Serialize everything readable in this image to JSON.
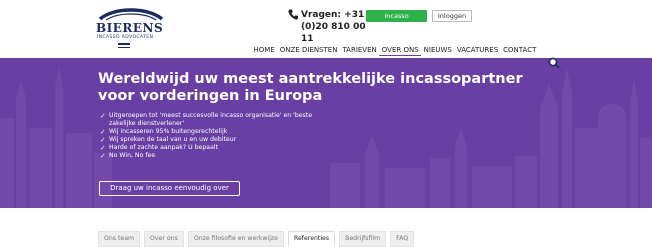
{
  "brand": {
    "name": "BIERENS",
    "tagline": "INCASSO ADVOCATEN"
  },
  "header": {
    "phone_label": "Vragen: +31 (0)20 810 00 11",
    "cta_button": "Incasso overdragen",
    "login_button": "Inloggen"
  },
  "nav": {
    "items": [
      {
        "label": "HOME",
        "active": false
      },
      {
        "label": "ONZE DIENSTEN",
        "active": false
      },
      {
        "label": "TARIEVEN",
        "active": false
      },
      {
        "label": "OVER ONS",
        "active": true
      },
      {
        "label": "NIEUWS",
        "active": false
      },
      {
        "label": "VACATURES",
        "active": false
      },
      {
        "label": "CONTACT",
        "active": false
      }
    ]
  },
  "hero": {
    "title": "Wereldwijd uw meest aantrekkelijke incassopartner voor vorderingen in Europa",
    "bullets": [
      "Uitgeroepen tot 'meest succesvolle incasso organisatie' en 'beste zakelijke dienstverlener'",
      "Wij incasseren 95% buitengerechtelijk",
      "Wij spreken de taal van u en uw debiteur",
      "Harde of zachte aanpak? U bepaalt",
      "No Win, No fee"
    ],
    "button": "Draag uw incasso eenvoudig over"
  },
  "tabs": [
    {
      "label": "Ons team",
      "active": false
    },
    {
      "label": "Over ons",
      "active": false
    },
    {
      "label": "Onze filosofie en werkwijze",
      "active": false
    },
    {
      "label": "Referenties",
      "active": true
    },
    {
      "label": "Bedrijfsfilm",
      "active": false
    },
    {
      "label": "FAQ",
      "active": false
    }
  ],
  "colors": {
    "brand_navy": "#1d2c5e",
    "hero_purple": "#6a3fa3",
    "cta_green": "#2fb14a"
  },
  "icons": [
    "phone-icon",
    "search-icon",
    "menu-icon",
    "check-icon"
  ]
}
